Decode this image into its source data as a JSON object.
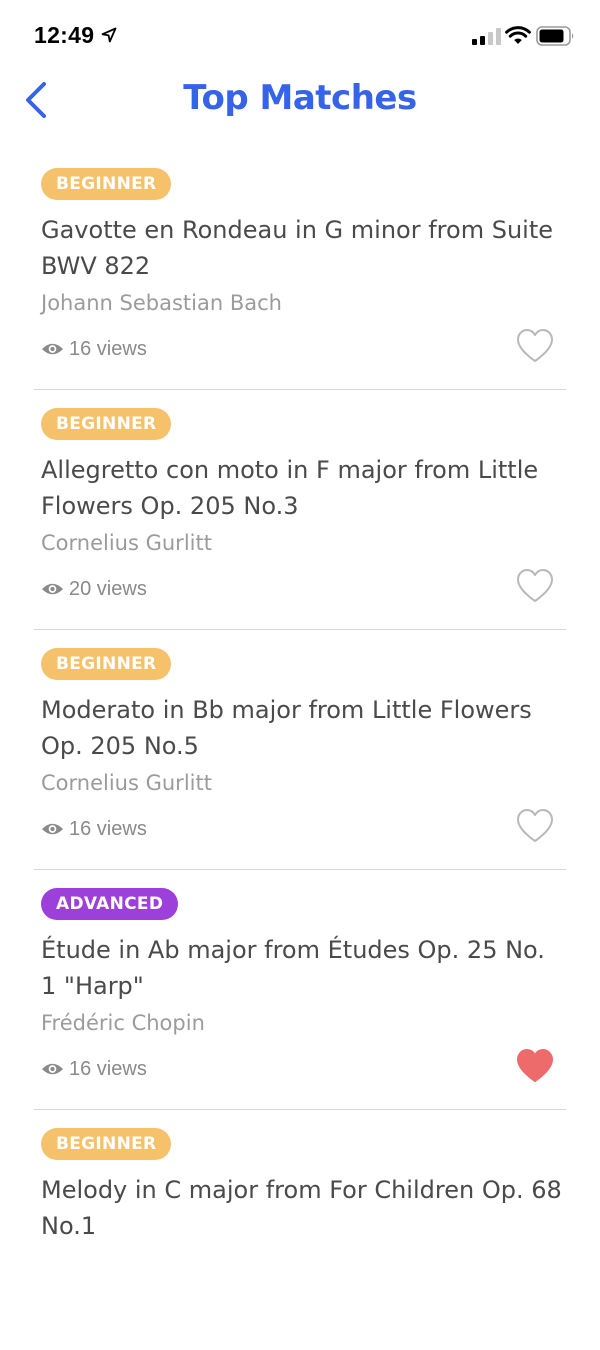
{
  "status_bar": {
    "time": "12:49",
    "icons": [
      "location-arrow-icon",
      "cellular-signal-icon",
      "wifi-icon",
      "battery-icon"
    ]
  },
  "header": {
    "back_icon": "chevron-left-icon",
    "title": "Top Matches"
  },
  "colors": {
    "accent": "#3563e9",
    "beginner": "#f5c26b",
    "advanced": "#9d3fd9",
    "heart_filled": "#ee6b6b",
    "heart_outline": "#b8b8b8"
  },
  "items": [
    {
      "level": "BEGINNER",
      "title": "Gavotte en Rondeau in G minor from Suite BWV 822",
      "composer": "Johann Sebastian Bach",
      "views": "16 views",
      "favorited": false
    },
    {
      "level": "BEGINNER",
      "title": "Allegretto con moto in F major from Little Flowers Op. 205 No.3",
      "composer": "Cornelius Gurlitt",
      "views": "20 views",
      "favorited": false
    },
    {
      "level": "BEGINNER",
      "title": "Moderato in Bb major from Little Flowers Op. 205 No.5",
      "composer": "Cornelius Gurlitt",
      "views": "16 views",
      "favorited": false
    },
    {
      "level": "ADVANCED",
      "title": "Étude in Ab major from Études Op. 25 No. 1 \"Harp\"",
      "composer": "Frédéric Chopin",
      "views": "16 views",
      "favorited": true
    },
    {
      "level": "BEGINNER",
      "title": "Melody in C major from For Children Op. 68 No.1"
    }
  ]
}
